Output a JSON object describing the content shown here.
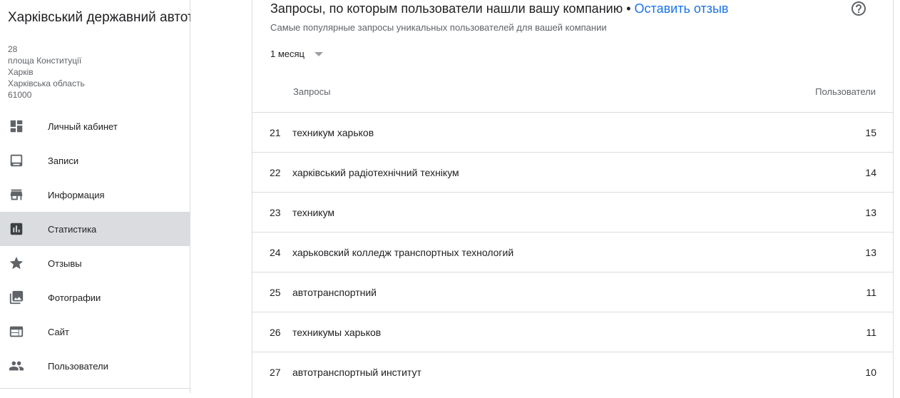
{
  "business": {
    "name": "Харківський державний автотранспортний коледж",
    "address": [
      "28",
      "площа Конституції",
      "Харків",
      "Харківська область",
      "61000"
    ]
  },
  "sidebar": {
    "items": [
      {
        "label": "Личный кабинет",
        "icon": "dashboard-icon"
      },
      {
        "label": "Записи",
        "icon": "posts-icon"
      },
      {
        "label": "Информация",
        "icon": "store-icon"
      },
      {
        "label": "Статистика",
        "icon": "insights-icon",
        "active": true
      },
      {
        "label": "Отзывы",
        "icon": "star-icon"
      },
      {
        "label": "Фотографии",
        "icon": "photos-icon"
      },
      {
        "label": "Сайт",
        "icon": "website-icon"
      },
      {
        "label": "Пользователи",
        "icon": "users-icon"
      }
    ]
  },
  "card": {
    "title": "Запросы, по которым пользователи нашли вашу компанию",
    "separator": "•",
    "review_link": "Оставить отзыв",
    "subtitle": "Самые популярные запросы уникальных пользователей для вашей компании",
    "period": "1 месяц",
    "columns": {
      "query": "Запросы",
      "users": "Пользователи"
    },
    "rows": [
      {
        "num": "21",
        "query": "техникум харьков",
        "users": "15"
      },
      {
        "num": "22",
        "query": "харківський радіотехнічний технікум",
        "users": "14"
      },
      {
        "num": "23",
        "query": "техникум",
        "users": "13"
      },
      {
        "num": "24",
        "query": "харьковский колледж транспортных технологий",
        "users": "13"
      },
      {
        "num": "25",
        "query": "автотранспортний",
        "users": "11"
      },
      {
        "num": "26",
        "query": "техникумы харьков",
        "users": "11"
      },
      {
        "num": "27",
        "query": "автотранспортный институт",
        "users": "10"
      }
    ]
  },
  "colors": {
    "link": "#1a73e8",
    "active_nav_bg": "#dadce0",
    "divider": "#dadce0"
  }
}
